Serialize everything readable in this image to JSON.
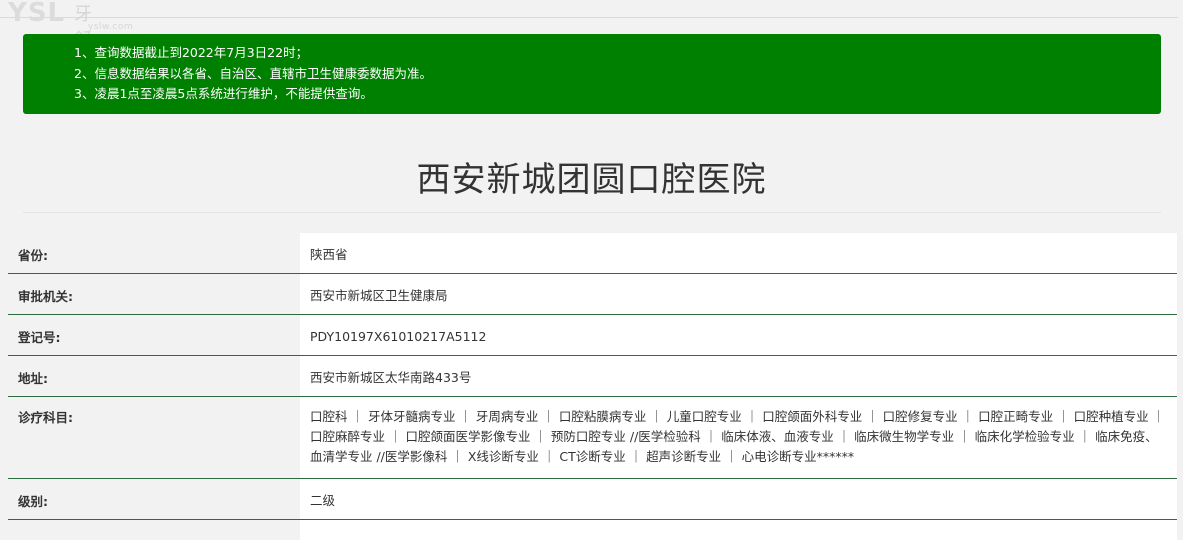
{
  "logo": {
    "brand": "YSL",
    "name": "牙舒丽",
    "domain": "yslw.com"
  },
  "notice": {
    "lines": [
      "1、查询数据截止到2022年7月3日22时；",
      "2、信息数据结果以各省、自治区、直辖市卫生健康委数据为准。",
      "3、凌晨1点至凌晨5点系统进行维护，不能提供查询。"
    ],
    "bg_color": "#008000"
  },
  "hospital": {
    "name": "西安新城团圆口腔医院"
  },
  "info": {
    "province": {
      "label": "省份:",
      "value": "陕西省"
    },
    "authority": {
      "label": "审批机关:",
      "value": "西安市新城区卫生健康局"
    },
    "reg_no": {
      "label": "登记号:",
      "value": "PDY10197X61010217A5112"
    },
    "address": {
      "label": "地址:",
      "value": "西安市新城区太华南路433号"
    },
    "departments": {
      "label": "诊疗科目:",
      "value": "口腔科 ｜ 牙体牙髓病专业 ｜ 牙周病专业 ｜ 口腔粘膜病专业 ｜ 儿童口腔专业 ｜ 口腔颌面外科专业 ｜ 口腔修复专业 ｜ 口腔正畸专业 ｜ 口腔种植专业 ｜ 口腔麻醉专业 ｜ 口腔颌面医学影像专业 ｜ 预防口腔专业 //医学检验科 ｜ 临床体液、血液专业 ｜ 临床微生物学专业 ｜ 临床化学检验专业 ｜ 临床免疫、血清学专业 //医学影像科 ｜ X线诊断专业 ｜ CT诊断专业 ｜ 超声诊断专业 ｜ 心电诊断专业******"
    },
    "level": {
      "label": "级别:",
      "value": "二级"
    }
  }
}
